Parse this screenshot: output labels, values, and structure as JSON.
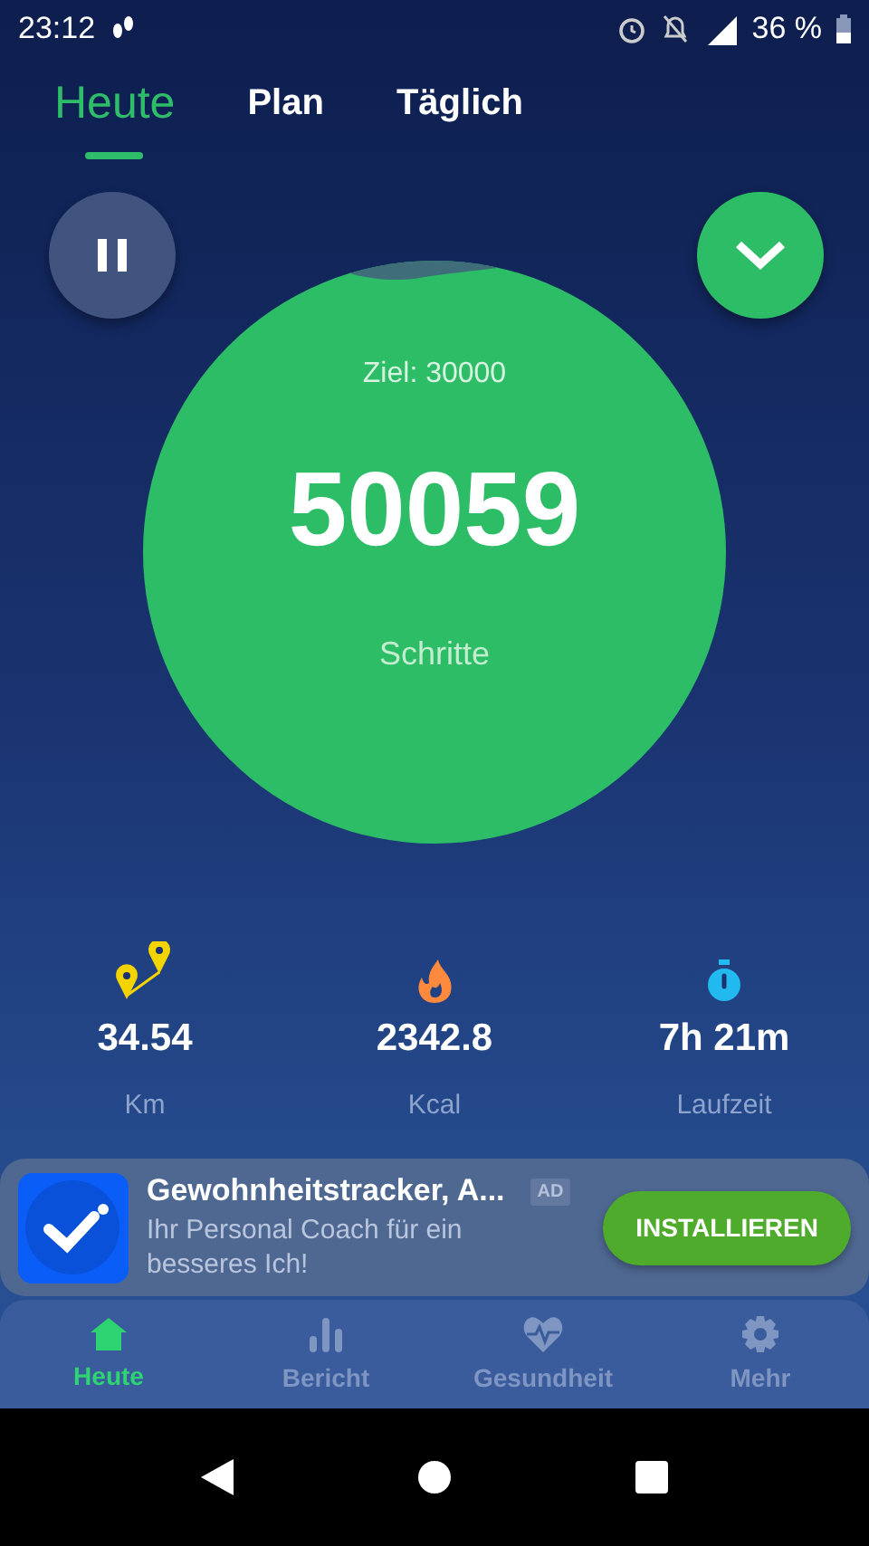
{
  "status_bar": {
    "time": "23:12",
    "battery": "36 %"
  },
  "tabs": [
    {
      "label": "Heute",
      "selected": true
    },
    {
      "label": "Plan",
      "selected": false
    },
    {
      "label": "Täglich",
      "selected": false
    }
  ],
  "step_circle": {
    "goal": "Ziel: 30000",
    "steps": "50059",
    "label": "Schritte"
  },
  "stats": [
    {
      "kind": "distance",
      "value": "34.54",
      "unit": "Km"
    },
    {
      "kind": "calories",
      "value": "2342.8",
      "unit": "Kcal"
    },
    {
      "kind": "time",
      "value": "7h 21m",
      "unit": "Laufzeit"
    }
  ],
  "ad": {
    "title": "Gewohnheitstracker, A...",
    "badge": "AD",
    "text": "Ihr Personal Coach für ein besseres Ich!",
    "button": "INSTALLIEREN"
  },
  "bottom_nav": [
    {
      "kind": "home",
      "label": "Heute",
      "selected": true
    },
    {
      "kind": "report",
      "label": "Bericht",
      "selected": false
    },
    {
      "kind": "health",
      "label": "Gesundheit",
      "selected": false
    },
    {
      "kind": "more",
      "label": "Mehr",
      "selected": false
    }
  ]
}
